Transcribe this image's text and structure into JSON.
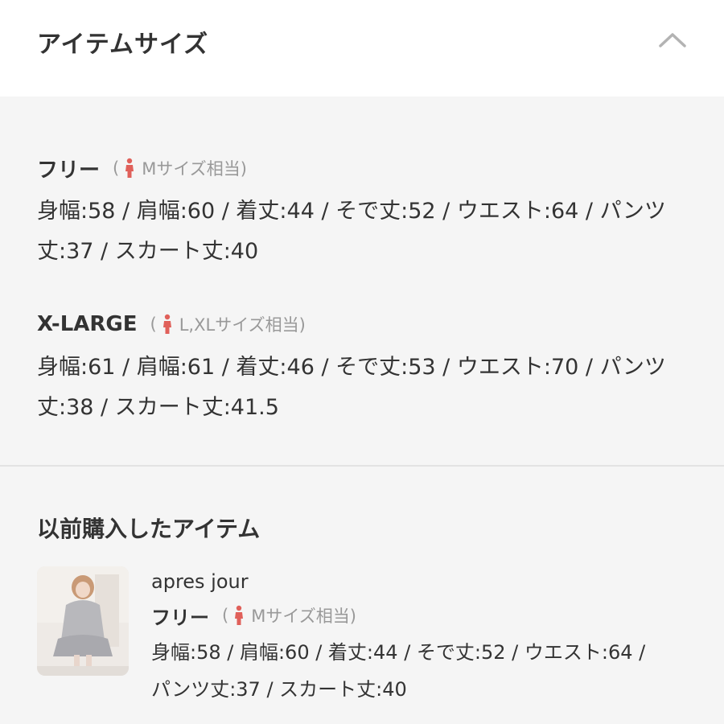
{
  "header": {
    "title": "アイテムサイズ",
    "toggle_icon": "chevron-up-icon"
  },
  "sizes": [
    {
      "name": "フリー",
      "equiv_open": "(",
      "equiv_text": "Mサイズ相当)",
      "measure_line1": "身幅:58 / 肩幅:60 / 着丈:44 / そで丈:52 / ウエスト:64 / パンツ",
      "measure_line2": "丈:37 / スカート丈:40"
    },
    {
      "name": "X-LARGE",
      "equiv_open": "(",
      "equiv_text": "L,XLサイズ相当)",
      "measure_line1": "身幅:61 / 肩幅:61 / 着丈:46 / そで丈:53 / ウエスト:70 / パンツ",
      "measure_line2": "丈:38 / スカート丈:41.5"
    }
  ],
  "previous": {
    "title": "以前購入したアイテム",
    "brand": "apres jour",
    "size_name": "フリー",
    "equiv_open": "(",
    "equiv_text": "Mサイズ相当)",
    "measure_line1": "身幅:58 / 肩幅:60 / 着丈:44 / そで丈:52 / ウエスト:64 /",
    "measure_line2": "パンツ丈:37 / スカート丈:40"
  },
  "colors": {
    "accent_person_icon": "#e0605a",
    "panel_background": "#f5f5f5",
    "header_background": "#ffffff",
    "muted_text": "#999999"
  }
}
